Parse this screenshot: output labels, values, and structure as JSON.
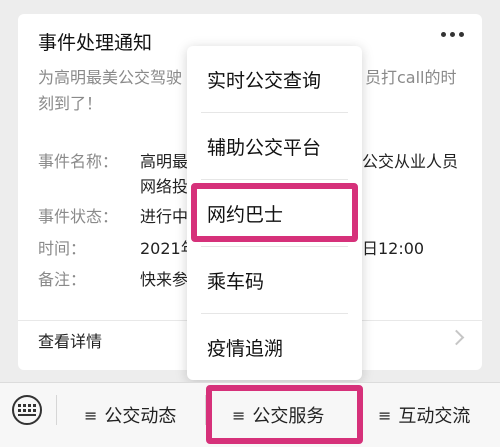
{
  "card": {
    "title": "事件处理通知",
    "description_part1": "为高明最美公交驾驶",
    "description_part2": "员打call的时",
    "description_line2": "刻到了！",
    "fields": [
      {
        "label": "事件名称：",
        "value_part1": "高明最",
        "value_part2": "公交从业人员",
        "value_line2": "网络投"
      },
      {
        "label": "事件状态：",
        "value_part1": "进行中",
        "value_part2": ""
      },
      {
        "label": "时间：",
        "value_part1": "2021年",
        "value_part2": "日12:00"
      },
      {
        "label": "备注：",
        "value_part1": "快来参",
        "value_part2": ""
      }
    ],
    "detail_link": "查看详情"
  },
  "popup_menu": {
    "items": [
      "实时公交查询",
      "辅助公交平台",
      "网约巴士",
      "乘车码",
      "疫情追溯"
    ],
    "highlighted": "网约巴士"
  },
  "bottom_menu": {
    "tabs": [
      "公交动态",
      "公交服务",
      "互动交流"
    ],
    "active": "公交服务"
  },
  "colors": {
    "highlight": "#d6317a",
    "background": "#ededed"
  }
}
